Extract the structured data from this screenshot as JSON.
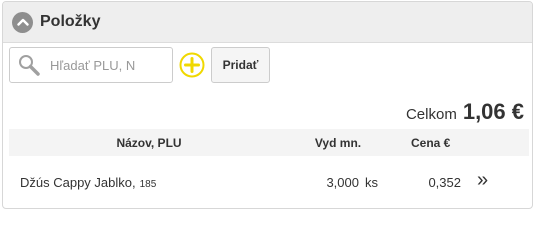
{
  "panel": {
    "title": "Položky"
  },
  "toolbar": {
    "search_placeholder": "Hľadať PLU, N",
    "add_label": "Pridať"
  },
  "total": {
    "label": "Celkom",
    "value": "1,06 €"
  },
  "table": {
    "columns": [
      "Názov, PLU",
      "Vyd mn.",
      "Cena €"
    ],
    "rows": [
      {
        "name": "Džús Cappy Jablko,",
        "plu": "185",
        "quantity": "3,000",
        "unit": "ks",
        "price": "0,352",
        "arrow": "»"
      }
    ]
  },
  "colors": {
    "header_bg": "#eeeeee",
    "add_icon": "#f0d800",
    "collapse_icon": "#8e8e8e"
  },
  "icons": [
    "chevron-up-icon",
    "search-icon",
    "plus-circle-icon",
    "double-chevron-right-icon"
  ]
}
